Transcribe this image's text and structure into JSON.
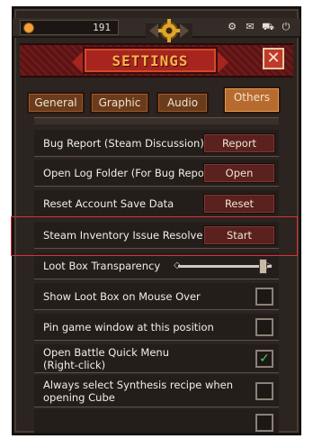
{
  "topbar": {
    "gold": "191",
    "icons": [
      "settings-gear",
      "mail",
      "cart",
      "power"
    ]
  },
  "title": "SETTINGS",
  "close_glyph": "✕",
  "tabs": [
    {
      "label": "General",
      "active": false
    },
    {
      "label": "Graphic",
      "active": false
    },
    {
      "label": "Audio",
      "active": false
    },
    {
      "label": "Others",
      "active": true
    }
  ],
  "rows": [
    {
      "label": "Bug Report (Steam Discussion)",
      "control": "button",
      "button": "Report"
    },
    {
      "label": "Open Log Folder (For Bug Report)",
      "control": "button",
      "button": "Open"
    },
    {
      "label": "Reset Account Save Data",
      "control": "button",
      "button": "Reset"
    },
    {
      "label": "Steam Inventory Issue Resolved",
      "control": "button",
      "button": "Start"
    },
    {
      "label": "Loot Box Transparency",
      "control": "slider",
      "value": 0.9
    },
    {
      "label": "Show Loot Box on Mouse Over",
      "control": "checkbox",
      "checked": false
    },
    {
      "label": "Pin game window at this position",
      "control": "checkbox",
      "checked": false
    },
    {
      "label": "Open Battle Quick Menu (Right-click)",
      "control": "checkbox",
      "checked": true
    },
    {
      "label": "Always select Synthesis recipe when opening Cube",
      "control": "checkbox",
      "checked": false
    }
  ],
  "colors": {
    "accent": "#ffb347",
    "highlight": "#d9303a",
    "check": "#43d15a"
  }
}
